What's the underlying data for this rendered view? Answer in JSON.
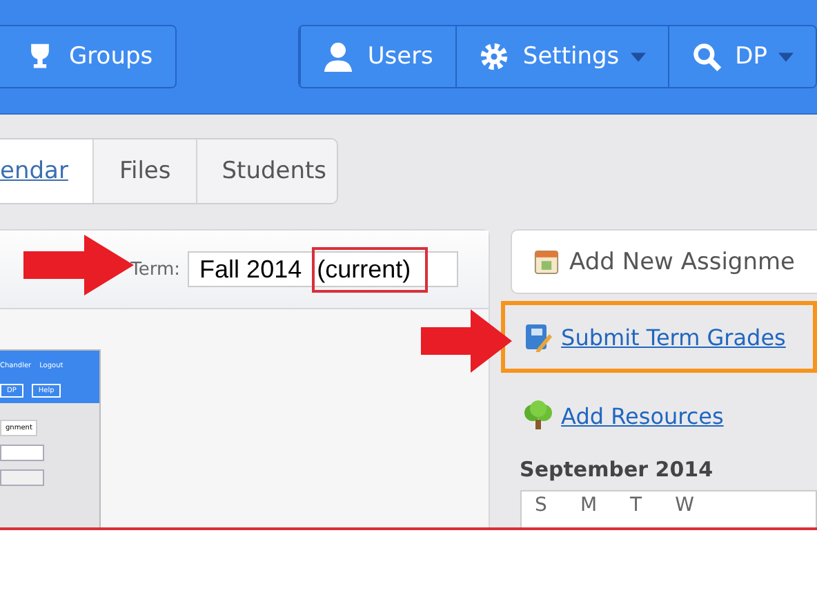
{
  "navbar": {
    "left_buttons": [
      {
        "label": "Groups",
        "dropdown": false
      }
    ],
    "right_buttons": [
      {
        "label": "Users",
        "dropdown": false
      },
      {
        "label": "Settings",
        "dropdown": true
      },
      {
        "label": "DP",
        "dropdown": true
      }
    ]
  },
  "tabs": [
    {
      "label": "endar",
      "selected": true
    },
    {
      "label": "Files",
      "selected": false
    },
    {
      "label": "Students",
      "selected": false
    }
  ],
  "term": {
    "label": "Term:",
    "value_parts": [
      {
        "text": "Fall 2014",
        "highlighted": false
      },
      {
        "text": "(current)",
        "highlighted": true
      }
    ]
  },
  "inset_screenshot": {
    "top_links": [
      "Chandler",
      "Logout"
    ],
    "buttons": [
      "DP",
      "Help"
    ],
    "button_text": "gnment"
  },
  "sidebar": {
    "add_button": "Add New Assignme",
    "links": [
      {
        "label": "Submit Term Grades",
        "highlighted": true
      },
      {
        "label": "Add Resources",
        "highlighted": false
      }
    ],
    "calendar_title": "September 2014",
    "weekdays": [
      "S",
      "M",
      "T",
      "W"
    ]
  }
}
